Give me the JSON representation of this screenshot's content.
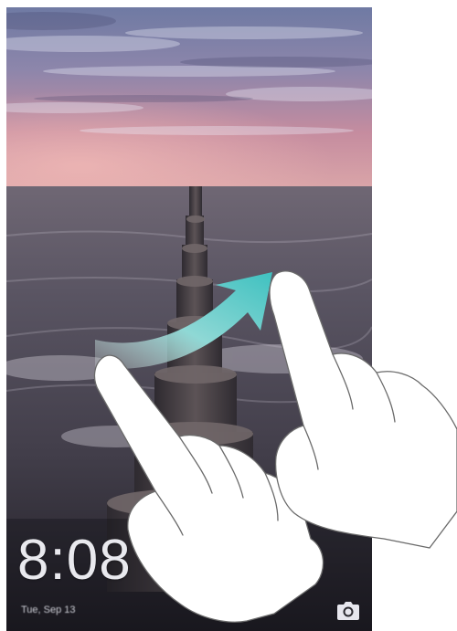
{
  "lock_screen": {
    "time": "8:08",
    "date": "Tue, Sep 13"
  },
  "icons": {
    "camera": "camera-icon",
    "swipe_arrow": "swipe-arrow-icon",
    "hand": "hand-pointer-icon"
  },
  "colors": {
    "swipe_arrow_start": "#e8f0ee",
    "swipe_arrow_end": "#3fc1c0",
    "sky_top": "#7d86ad",
    "sky_horizon": "#d08f9b",
    "sea": "#4a4550"
  }
}
